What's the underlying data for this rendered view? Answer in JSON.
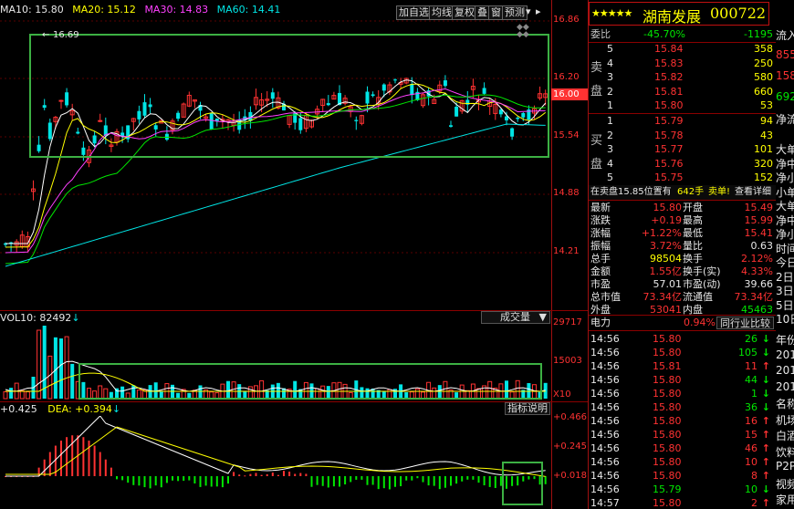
{
  "ma_legend": {
    "ma10": "MA10: 15.80",
    "ma20": "MA20: 15.12",
    "ma30": "MA30: 14.83",
    "ma60": "MA60: 14.41"
  },
  "toolbar": {
    "buttons": [
      "加自选",
      "均线",
      "复权",
      "叠",
      "窗",
      "预测"
    ]
  },
  "price_axis": [
    "16.86",
    "16.20",
    "16.00",
    "15.54",
    "14.88",
    "14.21"
  ],
  "current_price_tag": "16.00",
  "high_marker": "16.69",
  "volume": {
    "label": "VOL10: 82492",
    "dropdown": "成交量",
    "axis": [
      "29717",
      "15003",
      "X10"
    ]
  },
  "macd": {
    "label": "+0.425",
    "dea": "DEA: +0.394",
    "button": "指标说明",
    "axis": [
      "+0.466",
      "+0.245",
      "+0.018"
    ]
  },
  "quote": {
    "stars": "★★★★★",
    "name": "湖南发展",
    "code": "000722",
    "weibi_label": "委比",
    "weibi_value": "-45.70%",
    "weicha_value": "-1195",
    "sell_label": "卖盘",
    "buy_label": "买盘",
    "sell_book": [
      {
        "level": "5",
        "price": "15.84",
        "vol": "358"
      },
      {
        "level": "4",
        "price": "15.83",
        "vol": "250"
      },
      {
        "level": "3",
        "price": "15.82",
        "vol": "580"
      },
      {
        "level": "2",
        "price": "15.81",
        "vol": "660"
      },
      {
        "level": "1",
        "price": "15.80",
        "vol": "53"
      }
    ],
    "buy_book": [
      {
        "level": "1",
        "price": "15.79",
        "vol": "94"
      },
      {
        "level": "2",
        "price": "15.78",
        "vol": "43"
      },
      {
        "level": "3",
        "price": "15.77",
        "vol": "101"
      },
      {
        "level": "4",
        "price": "15.76",
        "vol": "320"
      },
      {
        "level": "5",
        "price": "15.75",
        "vol": "152"
      }
    ],
    "notice": "在卖盘15.85位置有",
    "notice_vol": "642手",
    "notice_tag": "卖单!",
    "notice_link": "查看详细",
    "stats": [
      {
        "l1": "最新",
        "v1": "15.80",
        "l2": "开盘",
        "v2": "15.49"
      },
      {
        "l1": "涨跌",
        "v1": "+0.19",
        "l2": "最高",
        "v2": "15.99"
      },
      {
        "l1": "涨幅",
        "v1": "+1.22%",
        "l2": "最低",
        "v2": "15.41"
      },
      {
        "l1": "振幅",
        "v1": "3.72%",
        "l2": "量比",
        "v2": "0.63"
      },
      {
        "l1": "总手",
        "v1": "98504",
        "l2": "换手",
        "v2": "2.12%"
      },
      {
        "l1": "金额",
        "v1": "1.55亿",
        "l2": "换手(实)",
        "v2": "4.33%"
      },
      {
        "l1": "市盈",
        "v1": "57.01",
        "l2": "市盈(动)",
        "v2": "39.66"
      },
      {
        "l1": "总市值",
        "v1": "73.34亿",
        "l2": "流通值",
        "v2": "73.34亿"
      },
      {
        "l1": "外盘",
        "v1": "53041",
        "l2": "内盘",
        "v2": "45463"
      }
    ],
    "sector_label": "电力",
    "sector_change": "0.94%",
    "sector_button": "同行业比较",
    "ticks": [
      {
        "time": "14:56",
        "price": "15.80",
        "vol": "26",
        "dir": "down"
      },
      {
        "time": "14:56",
        "price": "15.80",
        "vol": "105",
        "dir": "down"
      },
      {
        "time": "14:56",
        "price": "15.81",
        "vol": "11",
        "dir": "up"
      },
      {
        "time": "14:56",
        "price": "15.80",
        "vol": "44",
        "dir": "down"
      },
      {
        "time": "14:56",
        "price": "15.80",
        "vol": "1",
        "dir": "down"
      },
      {
        "time": "14:56",
        "price": "15.80",
        "vol": "36",
        "dir": "down"
      },
      {
        "time": "14:56",
        "price": "15.80",
        "vol": "16",
        "dir": "up"
      },
      {
        "time": "14:56",
        "price": "15.80",
        "vol": "15",
        "dir": "up"
      },
      {
        "time": "14:56",
        "price": "15.80",
        "vol": "46",
        "dir": "up"
      },
      {
        "time": "14:56",
        "price": "15.80",
        "vol": "10",
        "dir": "up"
      },
      {
        "time": "14:56",
        "price": "15.80",
        "vol": "8",
        "dir": "up"
      },
      {
        "time": "14:56",
        "price": "15.79",
        "vol": "10",
        "dir": "down"
      },
      {
        "time": "14:57",
        "price": "15.80",
        "vol": "2",
        "dir": "up"
      }
    ]
  },
  "far_right": {
    "top": [
      "流入",
      "855",
      "158",
      "692",
      "净流"
    ],
    "mid": [
      "大单",
      "净中",
      "净小",
      "小单",
      "大单",
      "净中",
      "净小",
      "时间",
      "今日",
      "2日",
      "3日",
      "5日",
      "10日"
    ],
    "bottom": [
      "年份",
      "201",
      "201",
      "201",
      "名称",
      "机场",
      "白酒",
      "饮料",
      "P2P",
      "视频",
      "家用"
    ]
  },
  "colors": {
    "up": "#ff3232",
    "down": "#00e600",
    "ma5": "#ffffff",
    "ma10": "#ffff00",
    "ma20": "#ff40ff",
    "ma30": "#00e600",
    "ma60": "#00e5e5",
    "highlight_box": "#3cb043"
  }
}
